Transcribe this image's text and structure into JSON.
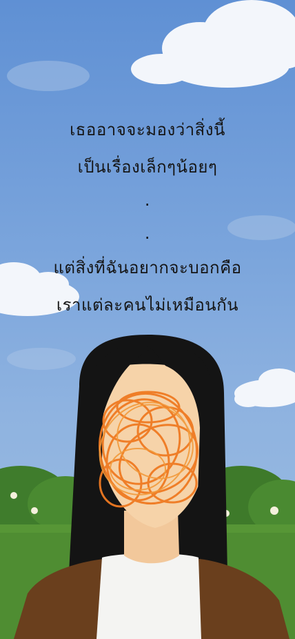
{
  "caption": {
    "line1": "เธออาจจะมองว่าสิ่งนี้",
    "line2": "เป็นเรื่องเล็กๆน้อยๆ",
    "dot1": ".",
    "dot2": ".",
    "line3": "แต่สิ่งที่ฉันอยากจะบอกคือ",
    "line4": "เราแต่ละคนไม่เหมือนกัน"
  },
  "colors": {
    "sky": "#6f9bd8",
    "cloud": "#f4f7fb",
    "grass": "#4f8d32",
    "bush": "#3e7a2a",
    "hair": "#151515",
    "skin": "#f6d3a9",
    "scribble": "#ef7a22",
    "jacket": "#6a3f1d",
    "shirt": "#f4f4f2"
  }
}
